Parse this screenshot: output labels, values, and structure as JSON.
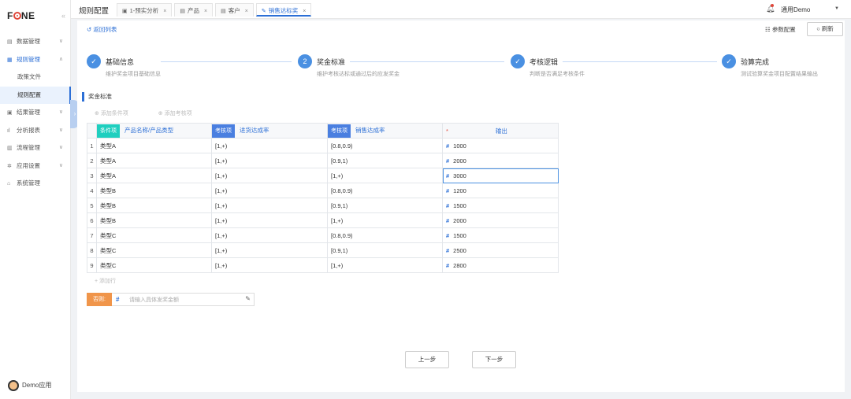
{
  "app": {
    "logo": "FONE"
  },
  "sidebar": {
    "items": [
      {
        "icon": "database-icon",
        "label": "数据管理",
        "arrow": "∨"
      },
      {
        "icon": "rules-icon",
        "label": "规则管理",
        "arrow": "∧",
        "open": true,
        "children": [
          {
            "label": "政策文件"
          },
          {
            "label": "规则配置",
            "active": true
          }
        ]
      },
      {
        "icon": "result-icon",
        "label": "结果管理",
        "arrow": "∨"
      },
      {
        "icon": "chart-icon",
        "label": "分析报表",
        "arrow": "∨"
      },
      {
        "icon": "flow-icon",
        "label": "流程管理",
        "arrow": "∨"
      },
      {
        "icon": "gear-icon",
        "label": "应用设置",
        "arrow": "∨"
      },
      {
        "icon": "bank-icon",
        "label": "系统管理",
        "arrow": ""
      }
    ],
    "user": "Demo应用"
  },
  "topbar": {
    "page_name": "规则配置",
    "tabs": [
      {
        "label": "1-预实分析"
      },
      {
        "label": "产品"
      },
      {
        "label": "客户"
      },
      {
        "label": "销售达标奖",
        "active": true
      }
    ],
    "user_name": "通用Demo"
  },
  "panel": {
    "back": "返回列表",
    "param_config": "参数配置",
    "refresh": "刷新"
  },
  "steps": [
    {
      "num": "✓",
      "title": "基础信息",
      "desc": "维护奖金项目基础信息",
      "done": true
    },
    {
      "num": "2",
      "title": "奖金标准",
      "desc": "维护考核达标或通过后的应发奖金",
      "done": false
    },
    {
      "num": "✓",
      "title": "考核逻辑",
      "desc": "判断是否满足考核条件",
      "done": true
    },
    {
      "num": "✓",
      "title": "验算完成",
      "desc": "测试验算奖金项目配置结果输出",
      "done": true
    }
  ],
  "section": {
    "title": "奖金标准",
    "add_condition": "添加条件项",
    "add_check": "添加考核项",
    "add_row": "+ 添加行"
  },
  "table": {
    "headers": [
      {
        "tag": "条件项",
        "label": "产品名称/产品类型",
        "tag_color": "teal"
      },
      {
        "tag": "考核项",
        "label": "进货达成率",
        "tag_color": "blue"
      },
      {
        "tag": "考核项",
        "label": "销售达成率",
        "tag_color": "blue"
      },
      {
        "required": "*",
        "label": "输出"
      }
    ],
    "rows": [
      {
        "idx": "1",
        "type": "类型A",
        "inbound": "[1,+)",
        "sales": "[0.8,0.9)",
        "output": "1000"
      },
      {
        "idx": "2",
        "type": "类型A",
        "inbound": "[1,+)",
        "sales": "[0.9,1)",
        "output": "2000"
      },
      {
        "idx": "3",
        "type": "类型A",
        "inbound": "[1,+)",
        "sales": "[1,+)",
        "output": "3000"
      },
      {
        "idx": "4",
        "type": "类型B",
        "inbound": "[1,+)",
        "sales": "[0.8,0.9)",
        "output": "1200"
      },
      {
        "idx": "5",
        "type": "类型B",
        "inbound": "[1,+)",
        "sales": "[0.9,1)",
        "output": "1500"
      },
      {
        "idx": "6",
        "type": "类型B",
        "inbound": "[1,+)",
        "sales": "[1,+)",
        "output": "2000"
      },
      {
        "idx": "7",
        "type": "类型C",
        "inbound": "[1,+)",
        "sales": "[0.8,0.9)",
        "output": "1500"
      },
      {
        "idx": "8",
        "type": "类型C",
        "inbound": "[1,+)",
        "sales": "[0.9,1)",
        "output": "2500"
      },
      {
        "idx": "9",
        "type": "类型C",
        "inbound": "[1,+)",
        "sales": "[1,+)",
        "output": "2800"
      }
    ]
  },
  "else_row": {
    "tag": "否则:",
    "placeholder": "请输入具体发奖金额"
  },
  "footer": {
    "prev": "上一步",
    "next": "下一步"
  }
}
